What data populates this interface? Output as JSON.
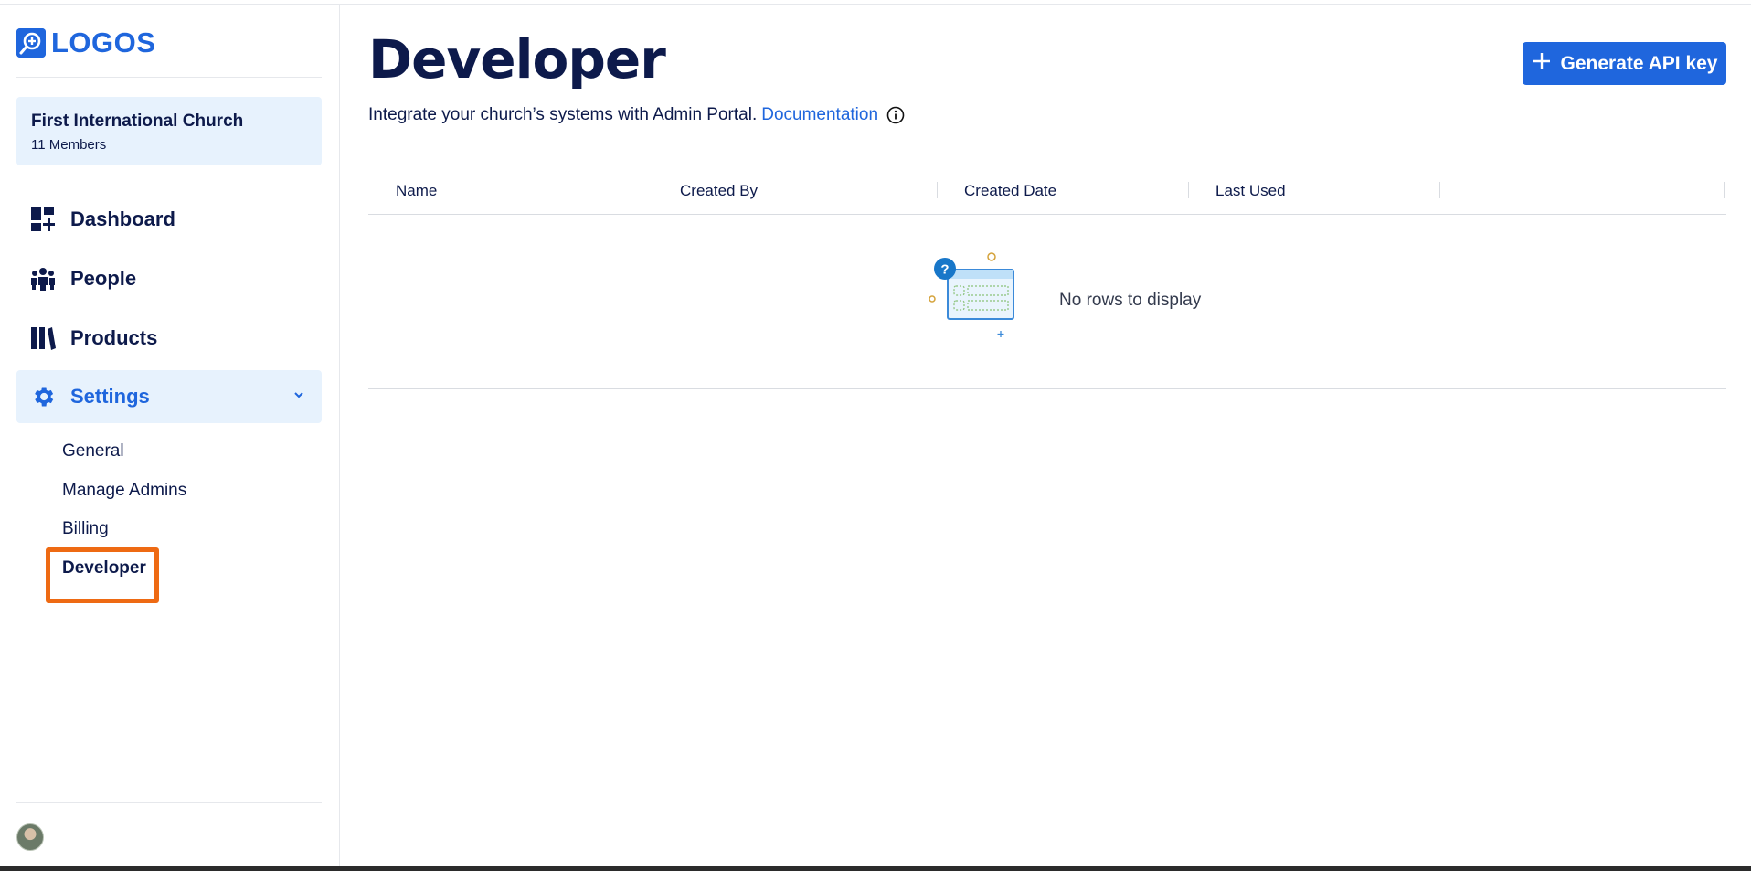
{
  "brand": {
    "name": "LOGOS",
    "color": "#1f66dd"
  },
  "org": {
    "name": "First International Church",
    "members": "11 Members"
  },
  "nav": {
    "items": [
      {
        "label": "Dashboard",
        "icon": "dashboard-icon"
      },
      {
        "label": "People",
        "icon": "people-icon"
      },
      {
        "label": "Products",
        "icon": "books-icon"
      },
      {
        "label": "Settings",
        "icon": "gear-icon",
        "active": true,
        "expanded": true
      }
    ],
    "settings_sub": [
      "General",
      "Manage Admins",
      "Billing",
      "Developer"
    ],
    "current_sub": "Developer"
  },
  "page": {
    "title": "Developer",
    "subtitle": "Integrate your church’s systems with Admin Portal.",
    "doc_link": "Documentation",
    "generate_button": "Generate API key"
  },
  "table": {
    "columns": [
      "Name",
      "Created By",
      "Created Date",
      "Last Used",
      ""
    ],
    "rows": [],
    "empty_text": "No rows to display"
  },
  "colors": {
    "accent": "#1f66dd",
    "text": "#0d1a4b",
    "active_bg": "#e7f2fd",
    "highlight": "#ee6a13"
  }
}
